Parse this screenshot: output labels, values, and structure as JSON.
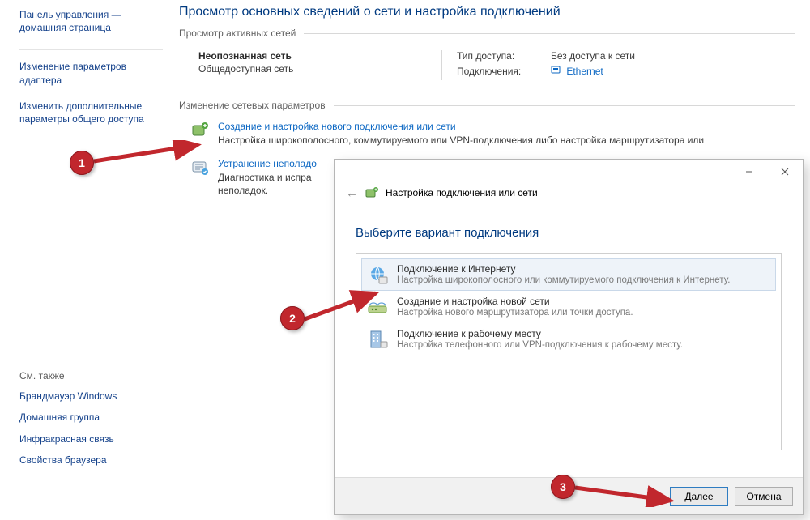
{
  "sidebar": {
    "title": "Панель управления — домашняя страница",
    "links": [
      "Изменение параметров адаптера",
      "Изменить дополнительные параметры общего доступа"
    ],
    "see_also_h": "См. также",
    "see_also": [
      "Брандмауэр Windows",
      "Домашняя группа",
      "Инфракрасная связь",
      "Свойства браузера"
    ]
  },
  "content": {
    "heading": "Просмотр основных сведений о сети и настройка подключений",
    "active_networks_legend": "Просмотр активных сетей",
    "network": {
      "name": "Неопознанная сеть",
      "sub": "Общедоступная сеть",
      "access_type_label": "Тип доступа:",
      "access_type_value": "Без доступа к сети",
      "connections_label": "Подключения:",
      "connections_value": "Ethernet"
    },
    "change_settings_legend": "Изменение сетевых параметров",
    "tasks": [
      {
        "title": "Создание и настройка нового подключения или сети",
        "desc": "Настройка широкополосного, коммутируемого или VPN-подключения либо настройка маршрутизатора или"
      },
      {
        "title": "Устранение неполадо",
        "desc": "Диагностика и испра\nнеполадок."
      }
    ]
  },
  "dialog": {
    "nav_title": "Настройка подключения или сети",
    "heading": "Выберите вариант подключения",
    "options": [
      {
        "title": "Подключение к Интернету",
        "desc": "Настройка широкополосного или коммутируемого подключения к Интернету."
      },
      {
        "title": "Создание и настройка новой сети",
        "desc": "Настройка нового маршрутизатора или точки доступа."
      },
      {
        "title": "Подключение к рабочему месту",
        "desc": "Настройка телефонного или VPN-подключения к рабочему месту."
      }
    ],
    "next_label": "Далее",
    "cancel_label": "Отмена"
  },
  "markers": {
    "m1": "1",
    "m2": "2",
    "m3": "3"
  }
}
